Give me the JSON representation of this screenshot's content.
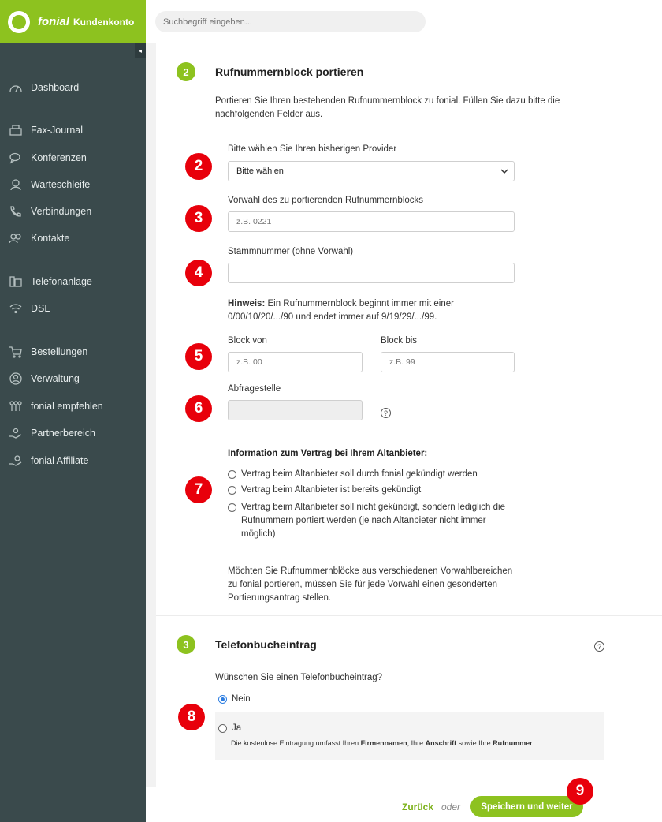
{
  "brand": {
    "name": "fonial",
    "sub": "Kundenkonto"
  },
  "search": {
    "placeholder": "Suchbegriff eingeben..."
  },
  "sidebar": {
    "collapse_icon": "◂",
    "items": [
      {
        "label": "Dashboard",
        "icon": "gauge-icon"
      },
      {
        "label": "Fax-Journal",
        "icon": "fax-icon"
      },
      {
        "label": "Konferenzen",
        "icon": "chat-icon"
      },
      {
        "label": "Warteschleife",
        "icon": "agent-icon"
      },
      {
        "label": "Verbindungen",
        "icon": "phone-icon"
      },
      {
        "label": "Kontakte",
        "icon": "contacts-icon"
      },
      {
        "label": "Telefonanlage",
        "icon": "pbx-icon"
      },
      {
        "label": "DSL",
        "icon": "wifi-icon"
      },
      {
        "label": "Bestellungen",
        "icon": "cart-icon"
      },
      {
        "label": "Verwaltung",
        "icon": "user-icon"
      },
      {
        "label": "fonial empfehlen",
        "icon": "people-icon"
      },
      {
        "label": "Partnerbereich",
        "icon": "handshake-icon"
      },
      {
        "label": "fonial Affiliate",
        "icon": "hand-coin-icon"
      }
    ]
  },
  "section2": {
    "step": "2",
    "title": "Rufnummernblock portieren",
    "intro_line1": "Portieren Sie Ihren bestehenden Rufnummernblock zu fonial. Füllen Sie dazu bitte die",
    "intro_line2": "nachfolgenden Felder aus.",
    "provider_label": "Bitte wählen Sie Ihren bisherigen Provider",
    "provider_value": "Bitte wählen",
    "vorwahl_label": "Vorwahl des zu portierenden Rufnummernblocks",
    "vorwahl_placeholder": "z.B. 0221",
    "stamm_label": "Stammnummer (ohne Vorwahl)",
    "stamm_placeholder": "",
    "hint_bold": "Hinweis:",
    "hint_line1": " Ein Rufnummernblock beginnt immer mit einer",
    "hint_line2": "0/00/10/20/.../90 und endet immer auf 9/19/29/.../99.",
    "block_von_label": "Block von",
    "block_von_placeholder": "z.B. 00",
    "block_bis_label": "Block bis",
    "block_bis_placeholder": "z.B. 99",
    "abfrage_label": "Abfragestelle",
    "help": "?",
    "contract_heading": "Information zum Vertrag bei Ihrem Altanbieter:",
    "contract_options": [
      "Vertrag beim Altanbieter soll durch fonial gekündigt werden",
      "Vertrag beim Altanbieter ist bereits gekündigt",
      "Vertrag beim Altanbieter soll nicht gekündigt, sondern lediglich die",
      "Rufnummern portiert werden (je nach Altanbieter nicht immer",
      "möglich)"
    ],
    "note_line1": "Möchten Sie Rufnummernblöcke aus verschiedenen Vorwahlbereichen",
    "note_line2": "zu fonial portieren, müssen Sie für jede Vorwahl einen gesonderten",
    "note_line3": "Portierungsantrag stellen."
  },
  "section3": {
    "step": "3",
    "title": "Telefonbucheintrag",
    "help": "?",
    "question": "Wünschen Sie einen Telefonbucheintrag?",
    "option_nein": "Nein",
    "option_ja": "Ja",
    "ja_text_1": "Die kostenlose Eintragung umfasst Ihren ",
    "ja_bold_1": "Firmennamen",
    "ja_text_2": ", Ihre ",
    "ja_bold_2": "Anschrift",
    "ja_text_3": " sowie Ihre ",
    "ja_bold_3": "Rufnummer",
    "ja_text_4": "."
  },
  "markers": [
    "2",
    "3",
    "4",
    "5",
    "6",
    "7",
    "8",
    "9"
  ],
  "footer": {
    "back": "Zurück",
    "or": "oder",
    "save": "Speichern und weiter"
  },
  "colors": {
    "brand_green": "#8dc21f",
    "sidebar": "#3a4a4c",
    "marker_red": "#e8000b",
    "radio_blue": "#2b7de1"
  }
}
